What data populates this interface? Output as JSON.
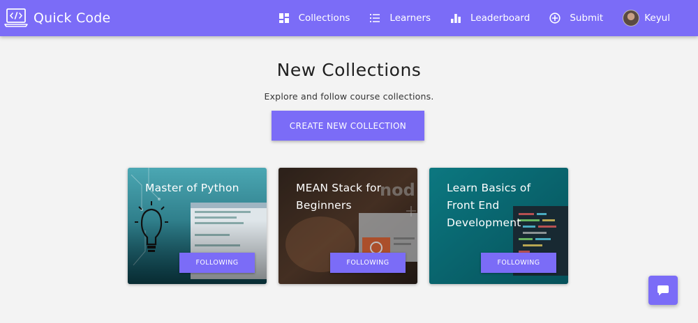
{
  "navbar": {
    "brand": "Quick Code",
    "links": [
      {
        "label": "Collections",
        "icon": "grid-icon"
      },
      {
        "label": "Learners",
        "icon": "list-icon"
      },
      {
        "label": "Leaderboard",
        "icon": "bar-chart-icon"
      },
      {
        "label": "Submit",
        "icon": "plus-circle-icon"
      }
    ],
    "user": {
      "name": "Keyul"
    }
  },
  "hero": {
    "title": "New Collections",
    "subtitle": "Explore and follow course collections.",
    "cta_label": "CREATE NEW COLLECTION"
  },
  "cards": [
    {
      "title": "Master of Python",
      "button": "FOLLOWING"
    },
    {
      "title": "MEAN Stack for Beginners",
      "button": "FOLLOWING"
    },
    {
      "title": "Learn Basics of Front End Development",
      "button": "FOLLOWING"
    }
  ],
  "colors": {
    "accent": "#7b6cf7",
    "background": "#f3f3f3"
  }
}
